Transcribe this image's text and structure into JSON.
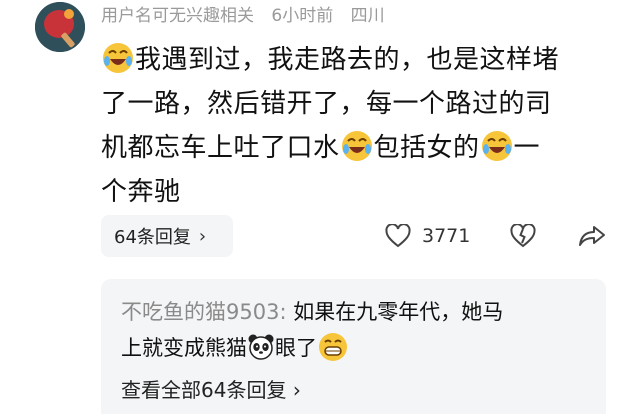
{
  "comment": {
    "author": "用户名可无兴趣相关",
    "time": "6小时前",
    "location": "四川",
    "text_lines": [
      "我遇到过，我走路去的，也是这样堵",
      "了一路，然后错开了，每一个路过的司",
      "机都忘车上吐了口水",
      "包括女的",
      "一",
      "个奔驰"
    ],
    "replies_button_label": "64条回复",
    "likes": "3771"
  },
  "icons": {
    "avatar": "ping-pong-paddle-avatar",
    "laugh_emoji": "laughing-crying-emoji",
    "panda_emoji": "panda-face-emoji",
    "grin_emoji": "grinning-emoji",
    "like": "heart-outline-icon",
    "dislike": "broken-heart-icon",
    "share": "share-arrow-icon",
    "chevron": "chevron-right-icon"
  },
  "reply_preview": {
    "author": "不吃鱼的猫9503:",
    "text_line1": " 如果在九零年代，她马",
    "text_line2_a": "上就变成熊猫",
    "text_line2_b": "眼了",
    "view_all_label": "查看全部64条回复"
  },
  "colors": {
    "meta_gray": "#9a9a9a",
    "pill_bg": "#f4f5f7",
    "emoji_yellow": "#f7c53a"
  }
}
